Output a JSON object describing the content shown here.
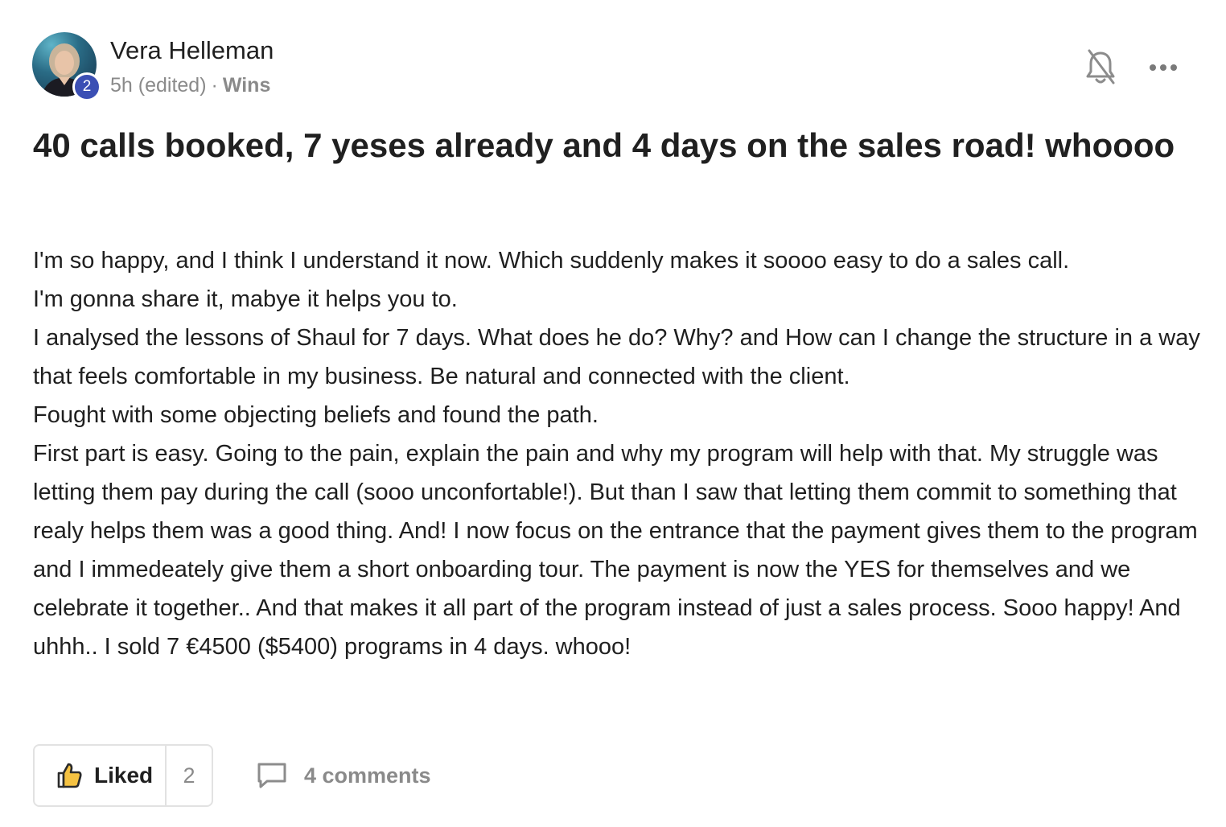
{
  "post": {
    "author": {
      "name": "Vera Helleman",
      "level": "2"
    },
    "meta": {
      "time": "5h (edited)",
      "separator": "·",
      "category": "Wins"
    },
    "icons": {
      "notify": "bell-off-icon",
      "more": "more-horizontal-icon",
      "like": "thumbs-up-icon",
      "comments": "comment-bubble-icon"
    },
    "title": "40 calls booked, 7 yeses already and 4 days on the sales road! whoooo",
    "body": [
      "I'm so happy, and I think I understand it now. Which suddenly makes it soooo easy to do a sales call.",
      "I'm gonna share it, mabye it helps you to.",
      "I analysed the lessons of Shaul for 7 days. What does he do? Why? and How can I change the structure in a way that feels comfortable in my business. Be natural and connected with the client.",
      "Fought with some objecting beliefs and found the path.",
      "First part is easy. Going to the pain, explain the pain and why my program will help with that. My struggle was letting them pay during the call (sooo unconfortable!). But than I saw that letting them commit to something that realy helps them was a good thing. And! I now focus on the entrance that the payment gives them to the program and I immedeately give them a short onboarding tour. The payment is now the YES for themselves and we celebrate it together.. And that makes it all part of the program instead of just a sales process. Sooo happy! And uhhh.. I sold 7 €4500 ($5400) programs in 4 days. whooo!"
    ],
    "actions": {
      "like_label": "Liked",
      "like_count": "2",
      "comments_label": "4 comments"
    }
  }
}
